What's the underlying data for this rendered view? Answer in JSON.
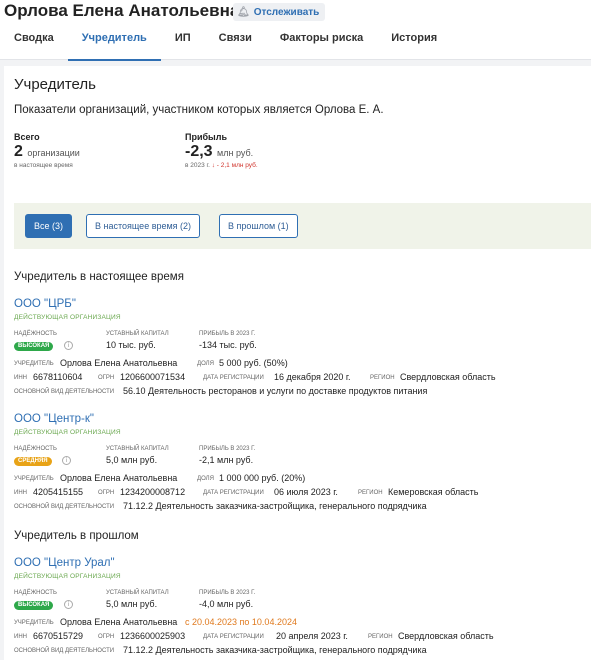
{
  "header": {
    "person_name": "Орлова Елена Анатольевна",
    "track_label": "Отслеживать",
    "tabs": [
      {
        "label": "Сводка"
      },
      {
        "label": "Учредитель"
      },
      {
        "label": "ИП"
      },
      {
        "label": "Связи"
      },
      {
        "label": "Факторы риска"
      },
      {
        "label": "История"
      }
    ],
    "active_tab": "Учредитель"
  },
  "main": {
    "title": "Учредитель",
    "subtitle": "Показатели организаций, участником которых является Орлова Е. А.",
    "stats": {
      "total_label": "Всего",
      "total_value": "2",
      "total_unit": "организации",
      "total_note": "в настоящее время",
      "profit_label": "Прибыль",
      "profit_value": "-2,3",
      "profit_unit": "млн руб.",
      "profit_note": "в 2023 г.",
      "profit_delta": "↓ - 2,1 млн руб."
    },
    "filters": [
      {
        "label": "Все (3)",
        "active": true
      },
      {
        "label": "В настоящее время (2)",
        "active": false
      },
      {
        "label": "В прошлом (1)",
        "active": false
      }
    ],
    "current_section_title": "Учредитель в настоящее время",
    "past_section_title": "Учредитель в прошлом",
    "labels": {
      "reliability": "Надёжность",
      "capital": "Уставный капитал",
      "profit": "Прибыль в 2023 г.",
      "founder": "Учредитель",
      "share": "Доля",
      "inn": "ИНН",
      "ogrn": "ОГРН",
      "reg_date": "Дата регистрации",
      "region": "Регион",
      "activity": "Основной вид деятельности"
    },
    "info_icon": "i",
    "organizations": [
      {
        "name": "ООО \"ЦРБ\"",
        "status": "Действующая организация",
        "reliability": "Высокая",
        "reliability_color": "#2ea84a",
        "capital": "10 тыс. руб.",
        "profit": "-134 тыс. руб.",
        "founder": "Орлова Елена Анатольевна",
        "share": "5 000 руб. (50%)",
        "inn": "6678110604",
        "ogrn": "1206600071534",
        "reg_date": "16 декабря 2020 г.",
        "region": "Свердловская область",
        "activity": "56.10 Деятельность ресторанов и услуги по доставке продуктов питания"
      },
      {
        "name": "ООО \"Центр-к\"",
        "status": "Действующая организация",
        "reliability": "Средняя",
        "reliability_color": "#e8a317",
        "capital": "5,0 млн руб.",
        "profit": "-2,1 млн руб.",
        "founder": "Орлова Елена Анатольевна",
        "share": "1 000 000 руб. (20%)",
        "inn": "4205415155",
        "ogrn": "1234200008712",
        "reg_date": "06 июля 2023 г.",
        "region": "Кемеровская область",
        "activity": "71.12.2 Деятельность заказчика-застройщика, генерального подрядчика"
      },
      {
        "name": "ООО \"Центр Урал\"",
        "status": "Действующая организация",
        "reliability": "Высокая",
        "reliability_color": "#2ea84a",
        "capital": "5,0 млн руб.",
        "profit": "-4,0 млн руб.",
        "founder": "Орлова Елена Анатольевна",
        "period": "с 20.04.2023 по 10.04.2024",
        "inn": "6670515729",
        "ogrn": "1236600025903",
        "reg_date": "20 апреля 2023 г.",
        "region": "Свердловская область",
        "activity": "71.12.2 Деятельность заказчика-застройщика, генерального подрядчика"
      }
    ]
  }
}
